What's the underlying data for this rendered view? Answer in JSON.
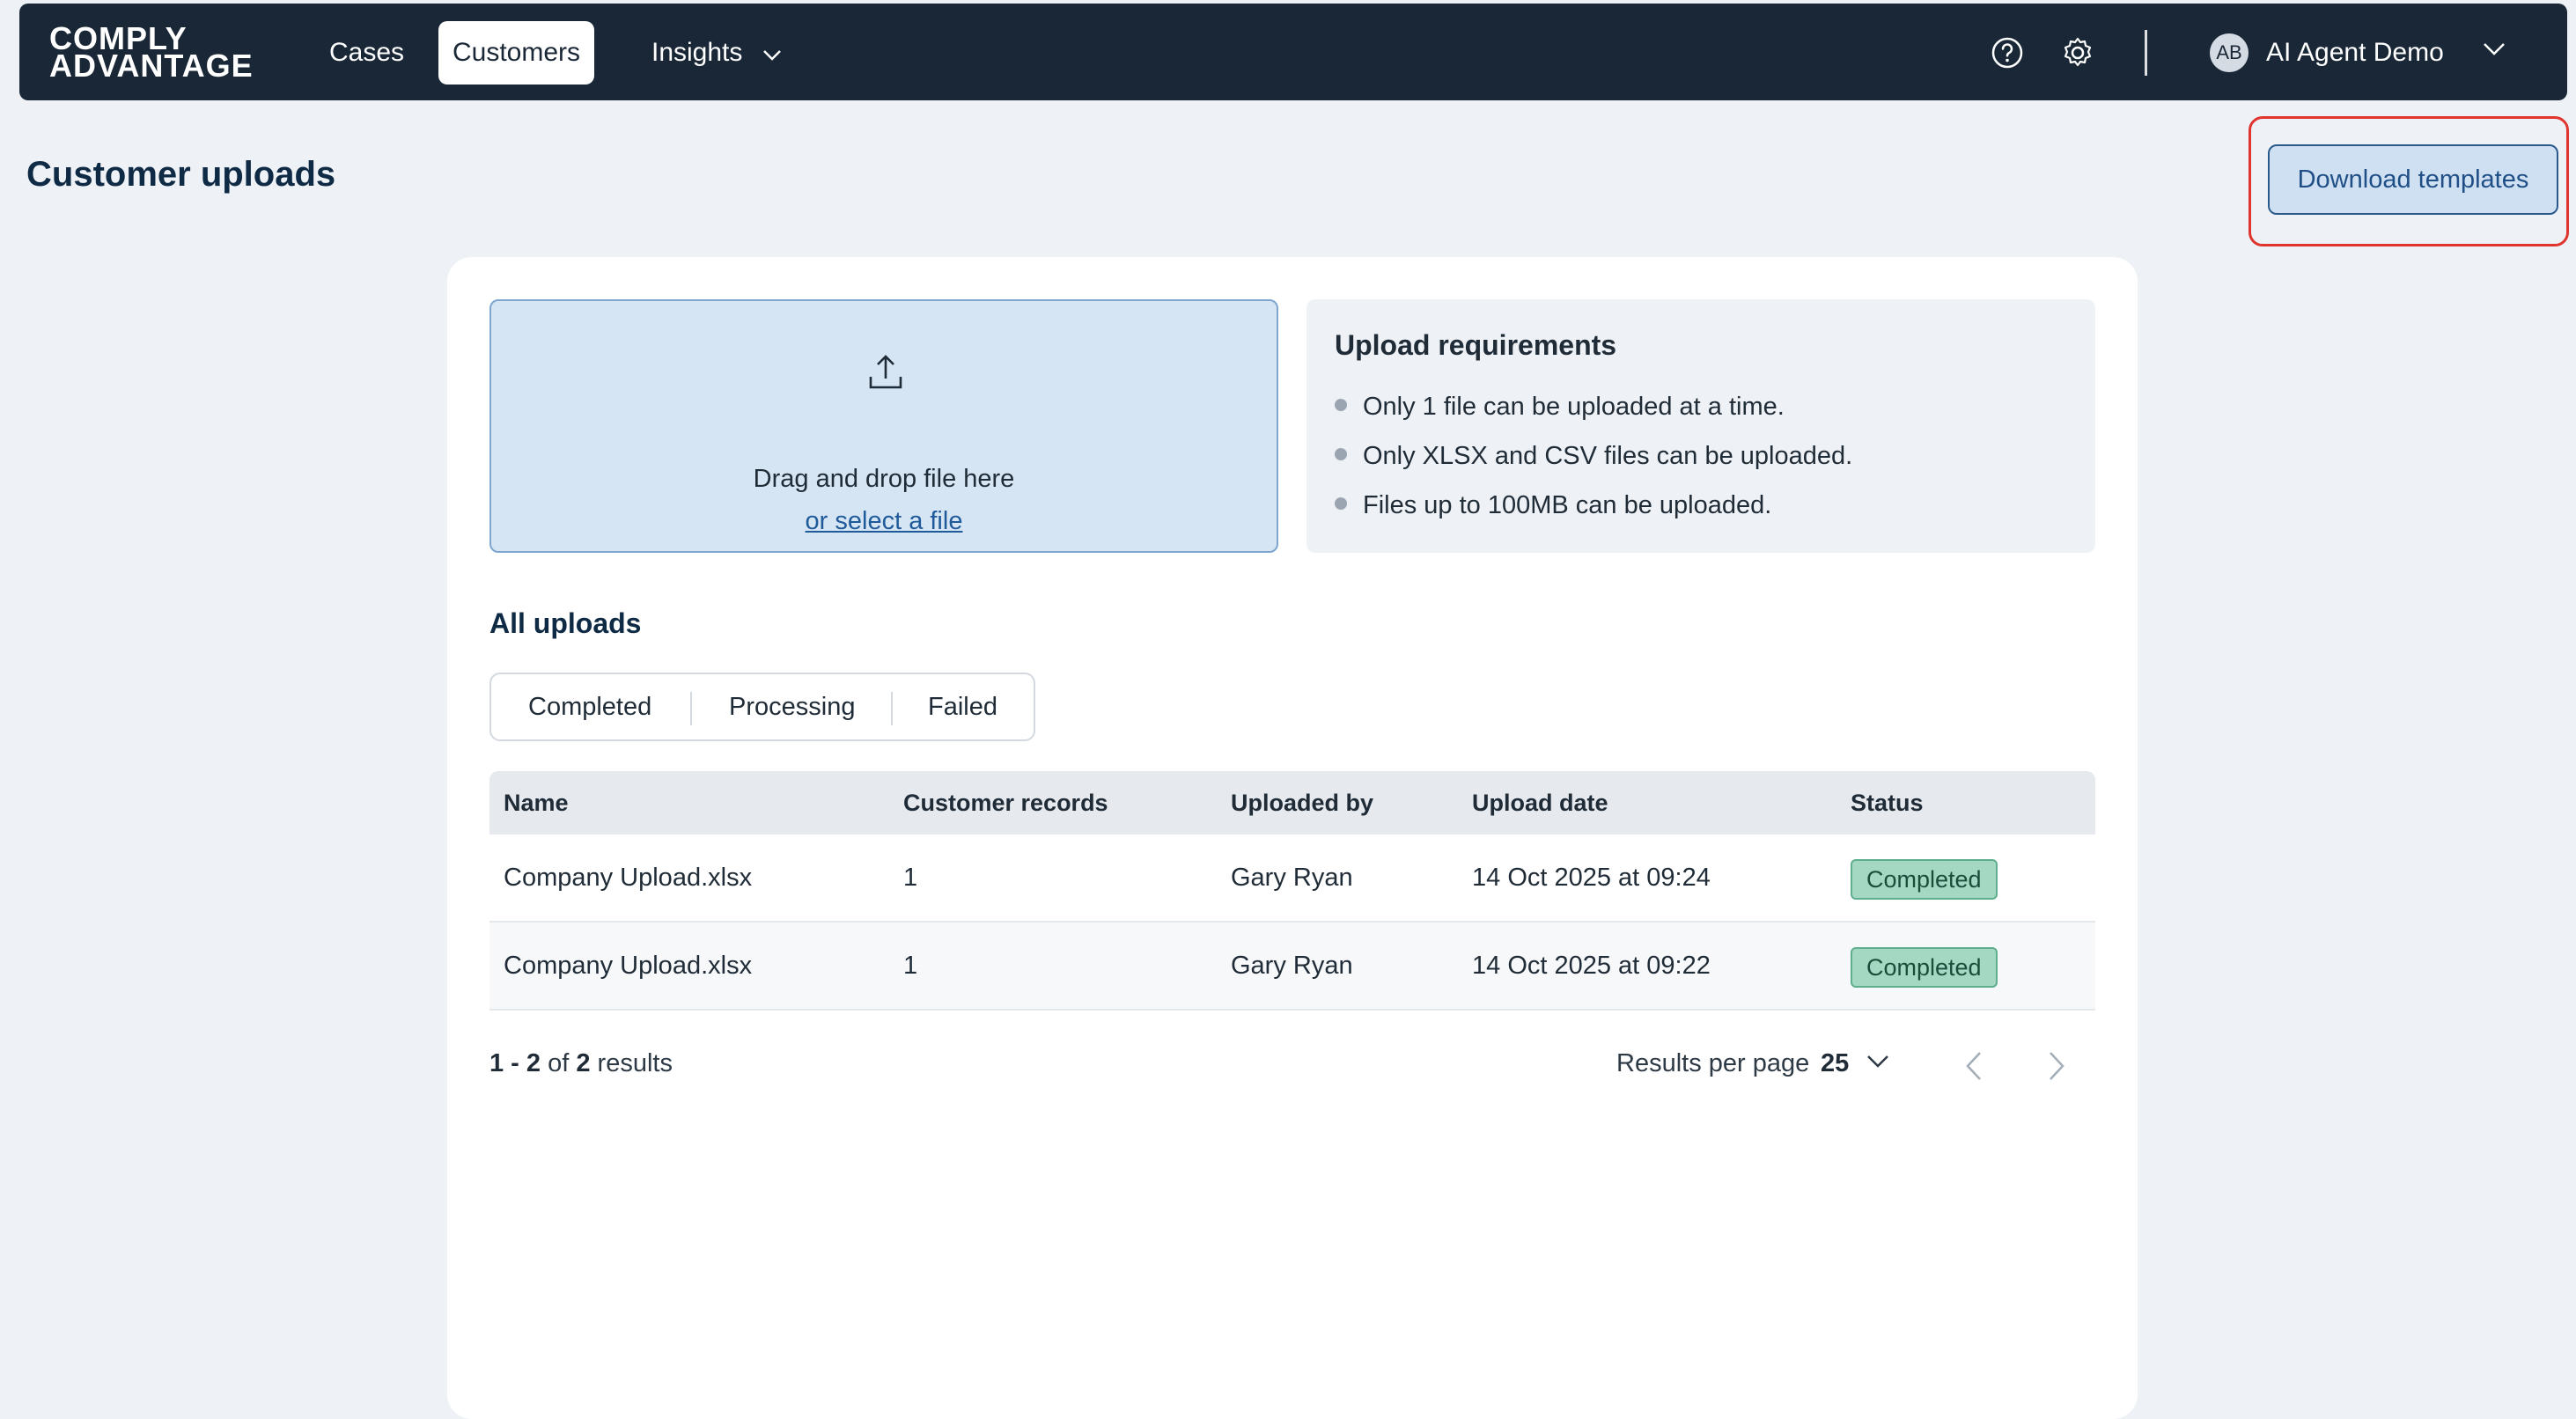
{
  "nav": {
    "logo_line1": "COMPLY",
    "logo_line2": "ADVANTAGE",
    "items": [
      {
        "label": "Cases"
      },
      {
        "label": "Customers"
      },
      {
        "label": "Insights"
      }
    ],
    "user_initials": "AB",
    "user_name": "AI Agent Demo"
  },
  "page": {
    "title": "Customer uploads",
    "download_button": "Download templates"
  },
  "dropzone": {
    "text": "Drag and drop file here",
    "link": "or select a file"
  },
  "requirements": {
    "title": "Upload requirements",
    "items": [
      "Only 1 file can be uploaded at a time.",
      "Only XLSX and CSV files can be uploaded.",
      "Files up to 100MB can be uploaded."
    ]
  },
  "uploads": {
    "title": "All uploads",
    "filters": [
      "Completed",
      "Processing",
      "Failed"
    ],
    "columns": [
      "Name",
      "Customer records",
      "Uploaded by",
      "Upload date",
      "Status"
    ],
    "rows": [
      {
        "name": "Company Upload.xlsx",
        "records": "1",
        "uploaded_by": "Gary Ryan",
        "date": "14 Oct 2025 at 09:24",
        "status": "Completed"
      },
      {
        "name": "Company Upload.xlsx",
        "records": "1",
        "uploaded_by": "Gary Ryan",
        "date": "14 Oct 2025 at 09:22",
        "status": "Completed"
      }
    ]
  },
  "pagination": {
    "range": "1 - 2",
    "of_word": "of",
    "total": "2",
    "results_word": "results",
    "per_page_label": "Results per page",
    "per_page_value": "25"
  },
  "colors": {
    "nav_bg": "#1a2736",
    "accent": "#1f5a9a",
    "status_completed": "#a5d8c3",
    "highlight": "#e0342f"
  }
}
